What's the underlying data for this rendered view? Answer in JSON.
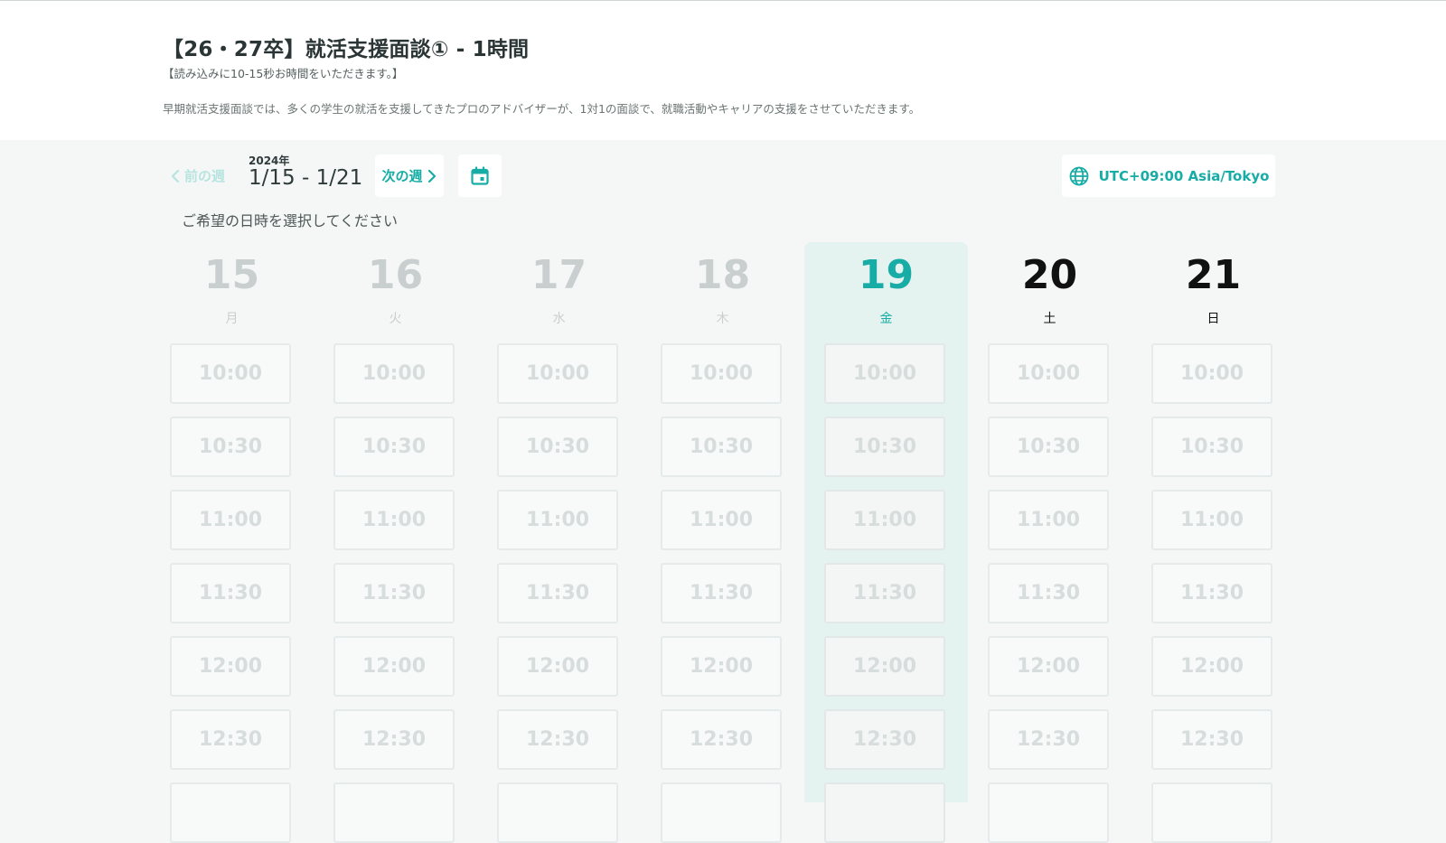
{
  "header": {
    "title": "【26・27卒】就活支援面談① - 1時間",
    "subtitle": "【読み込みに10-15秒お時間をいただきます。】",
    "description": "早期就活支援面談では、多くの学生の就活を支援してきたプロのアドバイザーが、1対1の面談で、就職活動やキャリアの支援をさせていただきます。"
  },
  "toolbar": {
    "prev_week_label": "前の週",
    "year": "2024年",
    "date_range": "1/15 - 1/21",
    "next_week_label": "次の週",
    "calendar_icon": "calendar-icon",
    "timezone_label": "UTC+09:00 Asia/Tokyo",
    "timezone_icon": "globe-icon"
  },
  "instruction": "ご希望の日時を選択してください",
  "colors": {
    "accent": "#17aca5",
    "selected_column_bg": "#e4f3ef",
    "past_text": "#c9cfce",
    "slot_border": "#e5ebea"
  },
  "days": [
    {
      "date": "15",
      "weekday": "月",
      "state": "past"
    },
    {
      "date": "16",
      "weekday": "火",
      "state": "past"
    },
    {
      "date": "17",
      "weekday": "水",
      "state": "past"
    },
    {
      "date": "18",
      "weekday": "木",
      "state": "past"
    },
    {
      "date": "19",
      "weekday": "金",
      "state": "selected"
    },
    {
      "date": "20",
      "weekday": "土",
      "state": "future"
    },
    {
      "date": "21",
      "weekday": "日",
      "state": "future"
    }
  ],
  "time_slots": [
    "10:00",
    "10:30",
    "11:00",
    "11:30",
    "12:00",
    "12:30"
  ]
}
